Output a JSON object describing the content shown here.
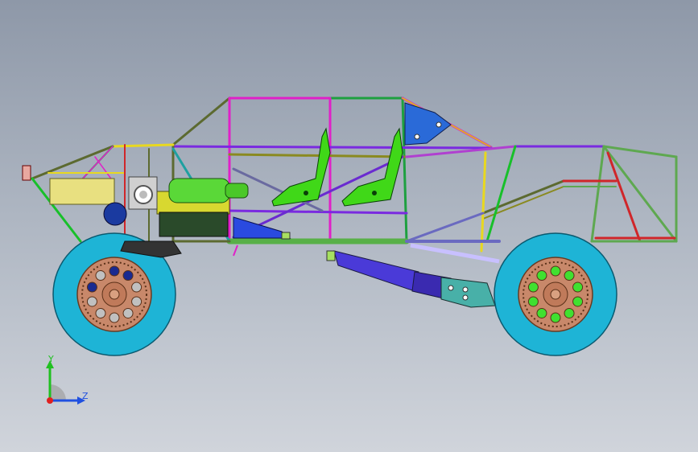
{
  "viewport": {
    "background_top": "#8e98a8",
    "background_bottom": "#d0d4db"
  },
  "model": {
    "colors": {
      "tire": "#1eb4d6",
      "rim": "#c8886a",
      "tube_magenta": "#e020c8",
      "tube_green": "#18c02a",
      "tube_yellow": "#f0e030",
      "tube_purple": "#6a2bd0",
      "tube_red": "#d0262a",
      "seat": "#40d818",
      "engine": "#5ad838",
      "blue_part": "#2a6ad8",
      "a_arm": "#4a3ad8",
      "knuckle": "#48b0a8"
    }
  },
  "triad": {
    "y_label": "Y",
    "z_label": "Z",
    "colors": {
      "y": "#20c020",
      "z": "#2050e0",
      "x": "#e02020"
    }
  }
}
